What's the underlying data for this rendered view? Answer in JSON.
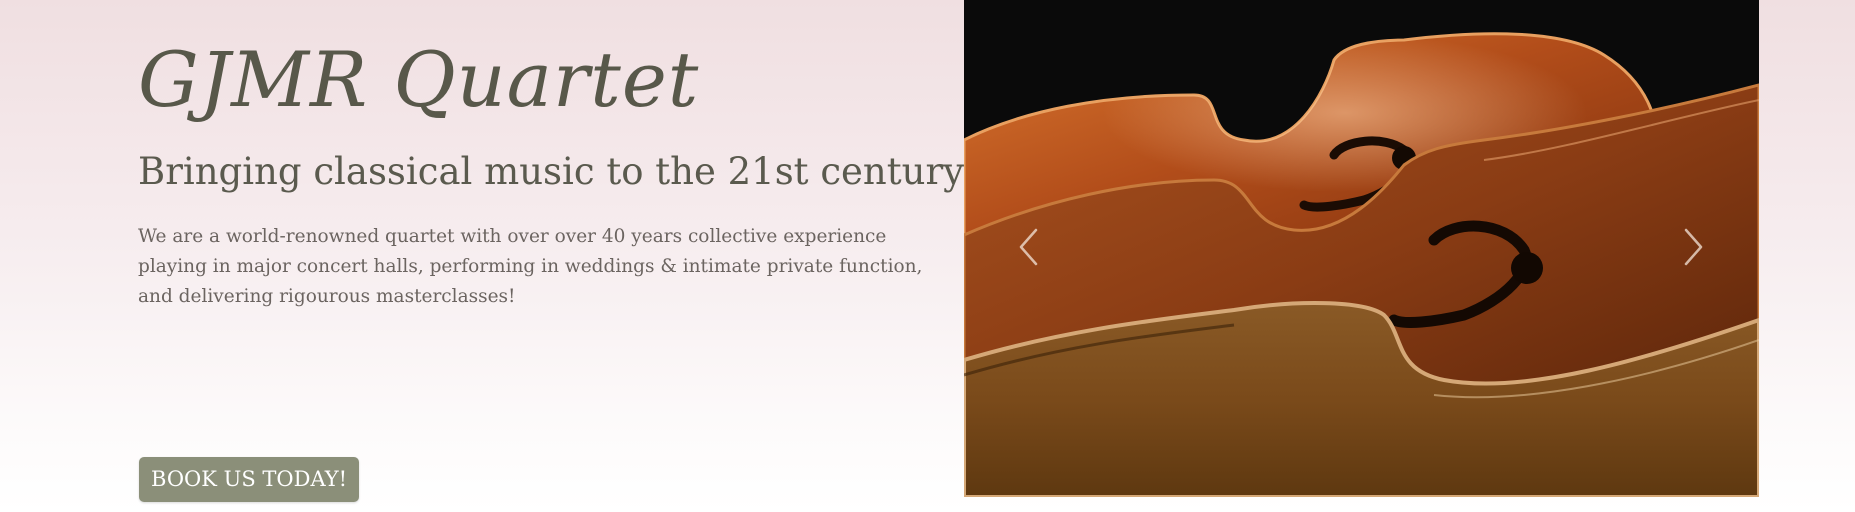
{
  "hero": {
    "title": "GJMR Quartet",
    "subtitle": "Bringing classical music to the 21st century",
    "description": "We are a world-renowned quartet with over over 40 years collective experience playing in major concert halls, performing in weddings & intimate private function, and delivering rigourous masterclasses!",
    "cta_label": "BOOK US TODAY!"
  },
  "carousel": {
    "image_subject": "violins-closeup",
    "prev_icon": "chevron-left-icon",
    "next_icon": "chevron-right-icon"
  },
  "colors": {
    "title": "#58584a",
    "button": "#8b8f79",
    "background_top": "#f0dfe1",
    "background_bottom": "#ffffff"
  }
}
